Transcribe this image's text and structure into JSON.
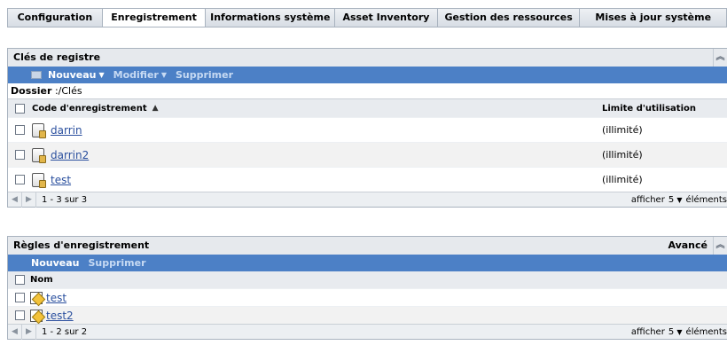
{
  "tabs": [
    {
      "label": "Configuration",
      "active": false
    },
    {
      "label": "Enregistrement",
      "active": true
    },
    {
      "label": "Informations système",
      "active": false
    },
    {
      "label": "Asset Inventory",
      "active": false
    },
    {
      "label": "Gestion des ressources",
      "active": false
    },
    {
      "label": "Mises à jour système",
      "active": false
    }
  ],
  "registry_keys": {
    "title": "Clés de registre",
    "toolbar": {
      "new": "Nouveau",
      "edit": "Modifier",
      "delete": "Supprimer"
    },
    "folder_label": "Dossier",
    "folder_path": " :/Clés",
    "columns": {
      "code": "Code d'enregistrement",
      "limit": "Limite d'utilisation"
    },
    "rows": [
      {
        "code": "darrin",
        "limit": "(illimité)"
      },
      {
        "code": "darrin2",
        "limit": "(illimité)"
      },
      {
        "code": "test",
        "limit": "(illimité)"
      }
    ],
    "pager": {
      "count": "1 - 3 sur 3",
      "show_prefix": "afficher",
      "page_size": "5",
      "show_suffix": "éléments"
    }
  },
  "registration_rules": {
    "title": "Règles d'enregistrement",
    "advanced": "Avancé",
    "toolbar": {
      "new": "Nouveau",
      "delete": "Supprimer"
    },
    "columns": {
      "name": "Nom"
    },
    "rows": [
      {
        "name": "test"
      },
      {
        "name": "test2"
      }
    ],
    "pager": {
      "count": "1 - 2 sur 2",
      "show_prefix": "afficher",
      "page_size": "5",
      "show_suffix": "éléments"
    }
  }
}
